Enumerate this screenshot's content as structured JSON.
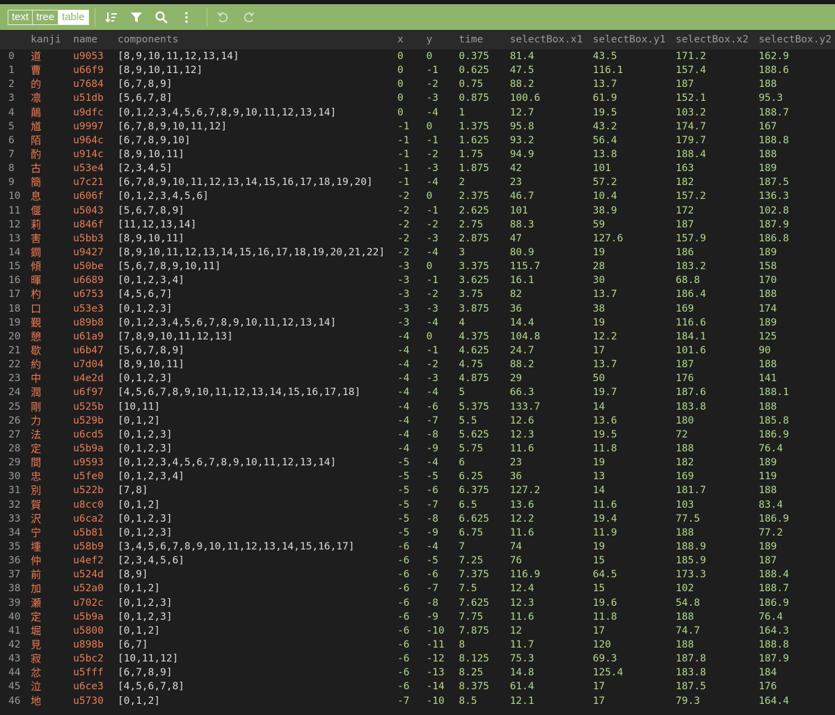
{
  "toolbar": {
    "modes": [
      "text",
      "tree",
      "table"
    ],
    "active_mode": "table",
    "icons": [
      "sort-icon",
      "filter-icon",
      "search-icon",
      "more-icon",
      "undo-icon",
      "redo-icon"
    ]
  },
  "colors": {
    "toolbar_bg": "#8fb46b",
    "background": "#1e1e1e",
    "header_bg": "#2a2a2a",
    "string_value": "#ee7b52",
    "number_value": "#b3d88a",
    "array_value": "#dcdcdc",
    "index": "#9a9a9a"
  },
  "table": {
    "columns": [
      "kanji",
      "name",
      "components",
      "x",
      "y",
      "time",
      "selectBox.x1",
      "selectBox.y1",
      "selectBox.x2",
      "selectBox.y2"
    ],
    "rows": [
      [
        "0",
        "道",
        "u9053",
        "[8,9,10,11,12,13,14]",
        "0",
        "0",
        "0.375",
        "81.4",
        "43.5",
        "171.2",
        "162.9"
      ],
      [
        "1",
        "曹",
        "u66f9",
        "[8,9,10,11,12]",
        "0",
        "-1",
        "0.625",
        "47.5",
        "116.1",
        "157.4",
        "188.6"
      ],
      [
        "2",
        "的",
        "u7684",
        "[6,7,8,9]",
        "0",
        "-2",
        "0.75",
        "88.2",
        "13.7",
        "187",
        "188"
      ],
      [
        "3",
        "凛",
        "u51db",
        "[5,6,7,8]",
        "0",
        "-3",
        "0.875",
        "100.6",
        "61.9",
        "152.1",
        "95.3"
      ],
      [
        "4",
        "鷏",
        "u9dfc",
        "[0,1,2,3,4,5,6,7,8,9,10,11,12,13,14]",
        "0",
        "-4",
        "1",
        "12.7",
        "19.5",
        "103.2",
        "188.7"
      ],
      [
        "5",
        "馗",
        "u9997",
        "[6,7,8,9,10,11,12]",
        "-1",
        "0",
        "1.375",
        "95.8",
        "43.2",
        "174.7",
        "167"
      ],
      [
        "6",
        "陌",
        "u964c",
        "[6,7,8,9,10]",
        "-1",
        "-1",
        "1.625",
        "93.2",
        "56.4",
        "179.7",
        "188.8"
      ],
      [
        "7",
        "酌",
        "u914c",
        "[8,9,10,11]",
        "-1",
        "-2",
        "1.75",
        "94.9",
        "13.8",
        "188.4",
        "188"
      ],
      [
        "8",
        "古",
        "u53e4",
        "[2,3,4,5]",
        "-1",
        "-3",
        "1.875",
        "42",
        "101",
        "163",
        "189"
      ],
      [
        "9",
        "簡",
        "u7c21",
        "[6,7,8,9,10,11,12,13,14,15,16,17,18,19,20]",
        "-1",
        "-4",
        "2",
        "23",
        "57.2",
        "182",
        "187.5"
      ],
      [
        "10",
        "息",
        "u606f",
        "[0,1,2,3,4,5,6]",
        "-2",
        "0",
        "2.375",
        "46.7",
        "10.4",
        "157.2",
        "136.3"
      ],
      [
        "11",
        "偃",
        "u5043",
        "[5,6,7,8,9]",
        "-2",
        "-1",
        "2.625",
        "101",
        "38.9",
        "172",
        "102.8"
      ],
      [
        "12",
        "莉",
        "u846f",
        "[11,12,13,14]",
        "-2",
        "-2",
        "2.75",
        "88.3",
        "59",
        "187",
        "187.9"
      ],
      [
        "13",
        "害",
        "u5bb3",
        "[8,9,10,11]",
        "-2",
        "-3",
        "2.875",
        "47",
        "127.6",
        "157.9",
        "186.8"
      ],
      [
        "14",
        "鐧",
        "u9427",
        "[8,9,10,11,12,13,14,15,16,17,18,19,20,21,22]",
        "-2",
        "-4",
        "3",
        "80.9",
        "19",
        "186",
        "189"
      ],
      [
        "15",
        "傾",
        "u50be",
        "[5,6,7,8,9,10,11]",
        "-3",
        "0",
        "3.375",
        "115.7",
        "28",
        "183.2",
        "158"
      ],
      [
        "16",
        "暉",
        "u6689",
        "[0,1,2,3,4]",
        "-3",
        "-1",
        "3.625",
        "16.1",
        "30",
        "68.8",
        "170"
      ],
      [
        "17",
        "杓",
        "u6753",
        "[4,5,6,7]",
        "-3",
        "-2",
        "3.75",
        "82",
        "13.7",
        "186.4",
        "188"
      ],
      [
        "18",
        "口",
        "u53e3",
        "[0,1,2,3]",
        "-3",
        "-3",
        "3.875",
        "36",
        "38",
        "169",
        "174"
      ],
      [
        "19",
        "覲",
        "u89b8",
        "[0,1,2,3,4,5,6,7,8,9,10,11,12,13,14]",
        "-3",
        "-4",
        "4",
        "14.4",
        "19",
        "116.6",
        "189"
      ],
      [
        "20",
        "憩",
        "u61a9",
        "[7,8,9,10,11,12,13]",
        "-4",
        "0",
        "4.375",
        "104.8",
        "12.2",
        "184.1",
        "125"
      ],
      [
        "21",
        "歇",
        "u6b47",
        "[5,6,7,8,9]",
        "-4",
        "-1",
        "4.625",
        "24.7",
        "17",
        "101.6",
        "90"
      ],
      [
        "22",
        "約",
        "u7d04",
        "[8,9,10,11]",
        "-4",
        "-2",
        "4.75",
        "88.2",
        "13.7",
        "187",
        "188"
      ],
      [
        "23",
        "中",
        "u4e2d",
        "[0,1,2,3]",
        "-4",
        "-3",
        "4.875",
        "29",
        "50",
        "176",
        "141"
      ],
      [
        "24",
        "潤",
        "u6f97",
        "[4,5,6,7,8,9,10,11,12,13,14,15,16,17,18]",
        "-4",
        "-4",
        "5",
        "66.3",
        "19.7",
        "187.6",
        "188.1"
      ],
      [
        "25",
        "剛",
        "u525b",
        "[10,11]",
        "-4",
        "-6",
        "5.375",
        "133.7",
        "14",
        "183.8",
        "188"
      ],
      [
        "26",
        "力",
        "u529b",
        "[0,1,2]",
        "-4",
        "-7",
        "5.5",
        "12.6",
        "13.6",
        "180",
        "185.8"
      ],
      [
        "27",
        "法",
        "u6cd5",
        "[0,1,2,3]",
        "-4",
        "-8",
        "5.625",
        "12.3",
        "19.5",
        "72",
        "186.9"
      ],
      [
        "28",
        "定",
        "u5b9a",
        "[0,1,2,3]",
        "-4",
        "-9",
        "5.75",
        "11.6",
        "11.8",
        "188",
        "76.4"
      ],
      [
        "29",
        "間",
        "u9593",
        "[0,1,2,3,4,5,6,7,8,9,10,11,12,13,14]",
        "-5",
        "-4",
        "6",
        "23",
        "19",
        "182",
        "189"
      ],
      [
        "30",
        "忠",
        "u5fe0",
        "[0,1,2,3,4]",
        "-5",
        "-5",
        "6.25",
        "36",
        "13",
        "169",
        "119"
      ],
      [
        "31",
        "別",
        "u522b",
        "[7,8]",
        "-5",
        "-6",
        "6.375",
        "127.2",
        "14",
        "181.7",
        "188"
      ],
      [
        "32",
        "賀",
        "u8cc0",
        "[0,1,2]",
        "-5",
        "-7",
        "6.5",
        "13.6",
        "11.6",
        "103",
        "83.4"
      ],
      [
        "33",
        "沢",
        "u6ca2",
        "[0,1,2,3]",
        "-5",
        "-8",
        "6.625",
        "12.2",
        "19.4",
        "77.5",
        "186.9"
      ],
      [
        "34",
        "宁",
        "u5b81",
        "[0,1,2,3]",
        "-5",
        "-9",
        "6.75",
        "11.6",
        "11.9",
        "188",
        "77.2"
      ],
      [
        "35",
        "堹",
        "u58b9",
        "[3,4,5,6,7,8,9,10,11,12,13,14,15,16,17]",
        "-6",
        "-4",
        "7",
        "74",
        "19",
        "188.9",
        "189"
      ],
      [
        "36",
        "仲",
        "u4ef2",
        "[2,3,4,5,6]",
        "-6",
        "-5",
        "7.25",
        "76",
        "15",
        "185.9",
        "187"
      ],
      [
        "37",
        "前",
        "u524d",
        "[8,9]",
        "-6",
        "-6",
        "7.375",
        "116.9",
        "64.5",
        "173.3",
        "188.4"
      ],
      [
        "38",
        "加",
        "u52a0",
        "[0,1,2]",
        "-6",
        "-7",
        "7.5",
        "12.4",
        "15",
        "102",
        "188.7"
      ],
      [
        "39",
        "瀬",
        "u702c",
        "[0,1,2,3]",
        "-6",
        "-8",
        "7.625",
        "12.3",
        "19.6",
        "54.8",
        "186.9"
      ],
      [
        "40",
        "定",
        "u5b9a",
        "[0,1,2,3]",
        "-6",
        "-9",
        "7.75",
        "11.6",
        "11.8",
        "188",
        "76.4"
      ],
      [
        "41",
        "堀",
        "u5800",
        "[0,1,2]",
        "-6",
        "-10",
        "7.875",
        "12",
        "17",
        "74.7",
        "164.3"
      ],
      [
        "42",
        "見",
        "u898b",
        "[6,7]",
        "-6",
        "-11",
        "8",
        "11.7",
        "120",
        "188",
        "188.8"
      ],
      [
        "43",
        "寂",
        "u5bc2",
        "[10,11,12]",
        "-6",
        "-12",
        "8.125",
        "75.3",
        "69.3",
        "187.8",
        "187.9"
      ],
      [
        "44",
        "忿",
        "u5fff",
        "[6,7,8,9]",
        "-6",
        "-13",
        "8.25",
        "14.8",
        "125.4",
        "183.8",
        "184"
      ],
      [
        "45",
        "泣",
        "u6ce3",
        "[4,5,6,7,8]",
        "-6",
        "-14",
        "8.375",
        "61.4",
        "17",
        "187.5",
        "176"
      ],
      [
        "46",
        "地",
        "u5730",
        "[0,1,2]",
        "-7",
        "-10",
        "8.5",
        "12.1",
        "17",
        "79.3",
        "164.4"
      ]
    ]
  }
}
